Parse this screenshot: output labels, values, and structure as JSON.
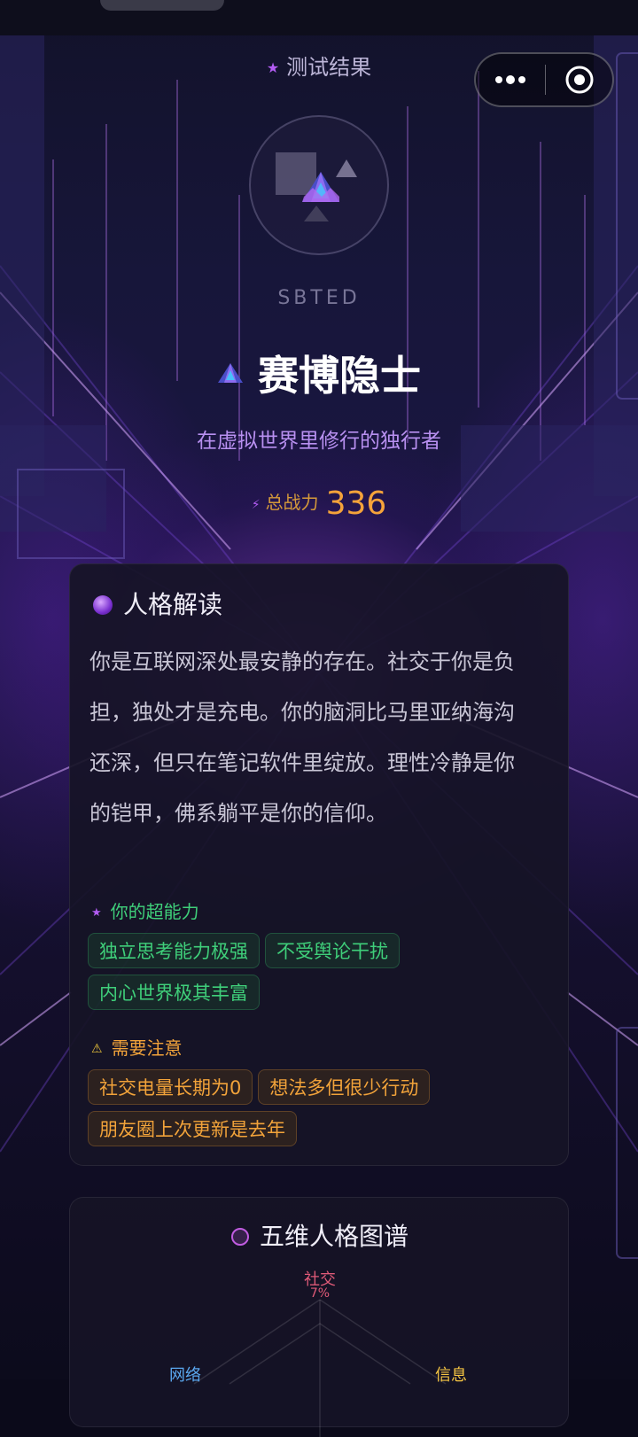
{
  "header": {
    "title": "测试结果"
  },
  "capsule": {
    "more_icon": "more-dots-icon",
    "close_icon": "target-circle-icon"
  },
  "result": {
    "code": "SBTED",
    "name": "赛博隐士",
    "tagline": "在虚拟世界里修行的独行者",
    "power_label": "总战力",
    "power_value": "336"
  },
  "interpretation": {
    "title": "人格解读",
    "description": "你是互联网深处最安静的存在。社交于你是负担，独处才是充电。你的脑洞比马里亚纳海沟还深，但只在笔记软件里绽放。理性冷静是你的铠甲，佛系躺平是你的信仰。",
    "superpower_label": "你的超能力",
    "superpowers": [
      "独立思考能力极强",
      "不受舆论干扰",
      "内心世界极其丰富"
    ],
    "warning_label": "需要注意",
    "warnings": [
      "社交电量长期为0",
      "想法多但很少行动",
      "朋友圈上次更新是去年"
    ]
  },
  "radar": {
    "title": "五维人格图谱",
    "labels": {
      "social": "社交",
      "social_value": "7%",
      "network": "网络",
      "info": "信息"
    }
  },
  "colors": {
    "accent_purple": "#b25cf2",
    "power_orange": "#f5a33a",
    "good_green": "#3fcf7a",
    "warn_orange": "#f2a33a",
    "social_red": "#e05a78",
    "network_blue": "#5aa8f0",
    "info_yellow": "#f5c542"
  }
}
